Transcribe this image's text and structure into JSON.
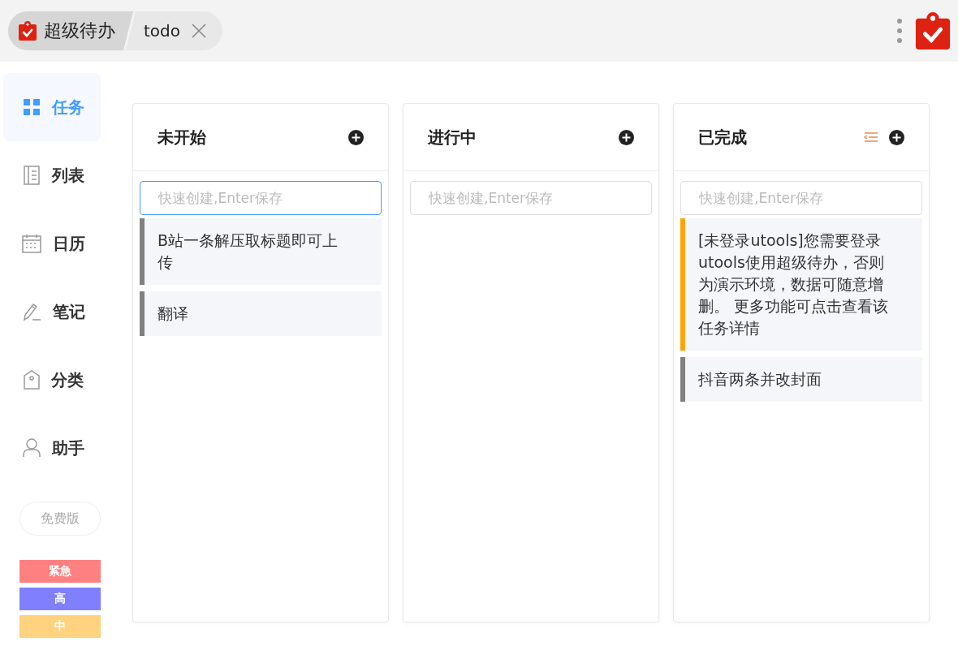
{
  "tabs": [
    {
      "label": "超级待办",
      "kind": "app",
      "selected": true
    },
    {
      "label": "todo",
      "kind": "plugin",
      "selected": false
    }
  ],
  "sidebar": {
    "items": [
      {
        "label": "任务",
        "kind": "grid",
        "selected": true
      },
      {
        "label": "列表",
        "kind": "list",
        "selected": false
      },
      {
        "label": "日历",
        "kind": "calendar",
        "selected": false
      },
      {
        "label": "笔记",
        "kind": "note",
        "selected": false
      },
      {
        "label": "分类",
        "kind": "tag",
        "selected": false
      },
      {
        "label": "助手",
        "kind": "user",
        "selected": false
      }
    ],
    "edition": "免费版",
    "priorities": [
      {
        "label": "紧急",
        "color": "#ff8080"
      },
      {
        "label": "高",
        "color": "#8080ff"
      },
      {
        "label": "中",
        "color": "#ffd280"
      }
    ]
  },
  "columns": [
    {
      "title": "未开始",
      "sortable": false,
      "input": {
        "placeholder": "快速创建,Enter保存",
        "focused": true
      },
      "cards": [
        {
          "text": "B站一条解压取标题即可上传",
          "color": "#808080"
        },
        {
          "text": "翻译",
          "color": "#808080"
        }
      ]
    },
    {
      "title": "进行中",
      "sortable": false,
      "input": {
        "placeholder": "快速创建,Enter保存",
        "focused": false
      }
    },
    {
      "title": "已完成",
      "sortable": true,
      "input": {
        "placeholder": "快速创建,Enter保存",
        "focused": false
      },
      "cards": [
        {
          "text": "[未登录utools]您需要登录utools使用超级待办，否则为演示环境，数据可随意增删。 更多功能可点击查看该任务详情",
          "color": "#ffa500"
        },
        {
          "text": "抖音两条并改封面",
          "color": "#808080"
        }
      ]
    }
  ]
}
